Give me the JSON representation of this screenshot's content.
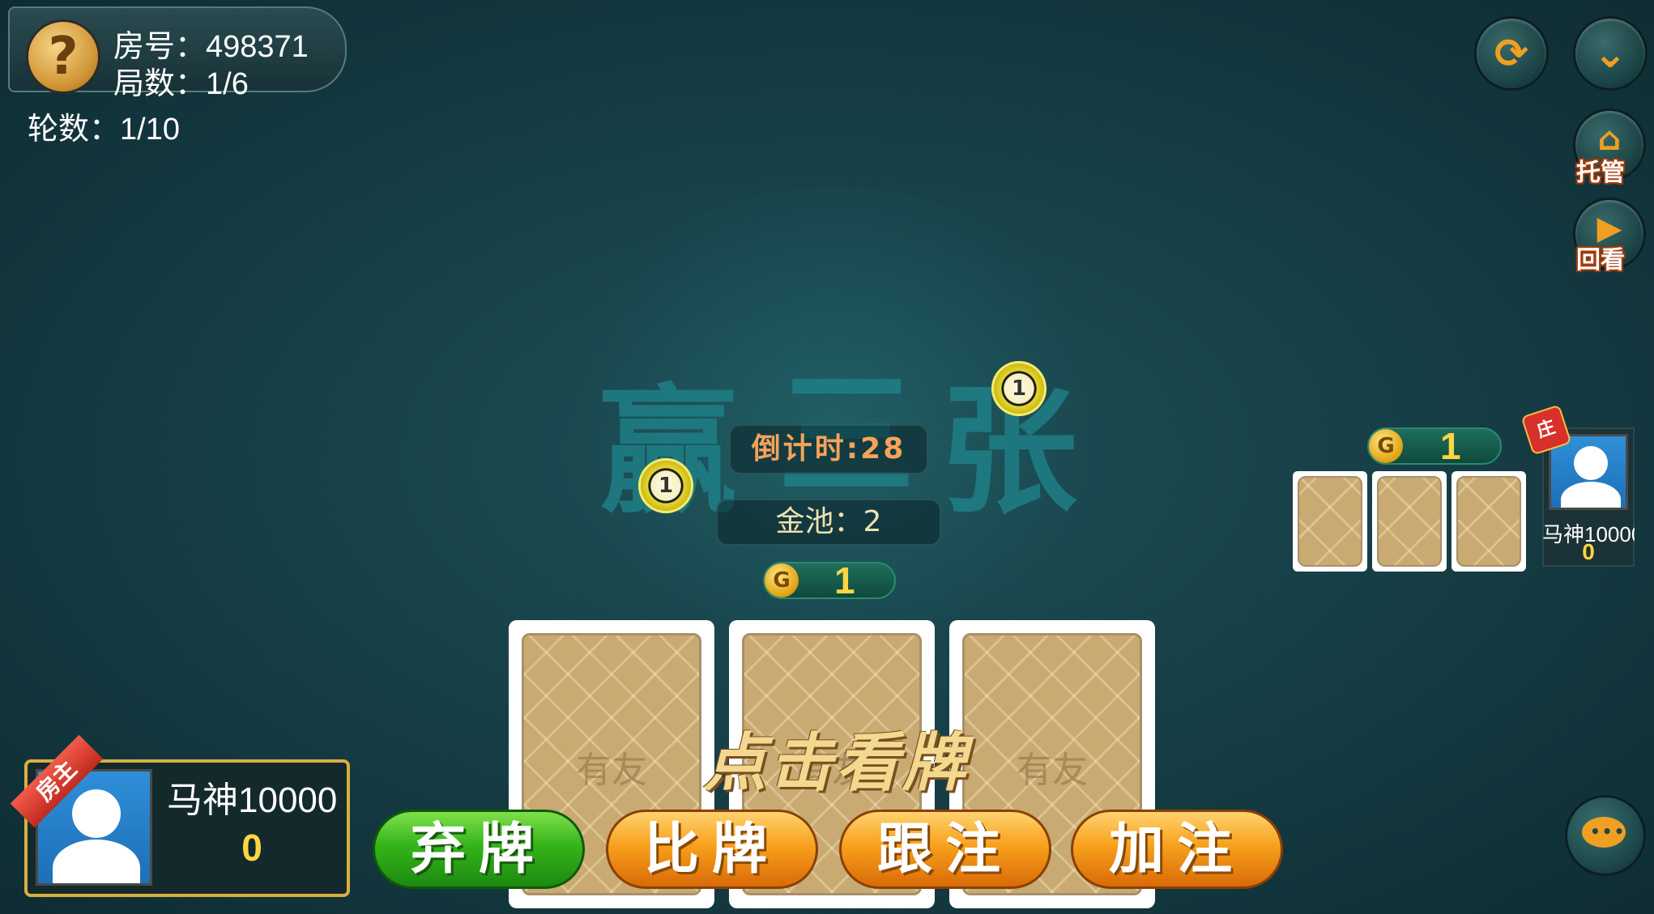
{
  "room": {
    "room_label": "房号：498371",
    "game_label": "局数：1/6",
    "round_label": "轮数：1/10"
  },
  "table": {
    "logo_text": [
      "赢",
      "三",
      "张"
    ],
    "countdown": "倒计时:28",
    "pot": "金池：2",
    "peek_hint": "点击看牌"
  },
  "controls": {
    "trustee_label": "托管",
    "replay_label": "回看"
  },
  "bets": {
    "self_bet": "1",
    "opponent_bet": "1",
    "chip_value": "1",
    "coin_symbol": "G"
  },
  "actions": {
    "fold": "弃牌",
    "compare": "比牌",
    "call": "跟注",
    "raise": "加注"
  },
  "self_player": {
    "badge": "房主",
    "name": "马神10000",
    "score": "0"
  },
  "opponent": {
    "badge": "庄",
    "name": "马神10000",
    "score": "0"
  },
  "card_back_mark": "有友",
  "colors": {
    "table": "#174048",
    "accent_gold": "#ffd640",
    "fold_green": "#35b41a",
    "action_orange": "#f7a11c"
  }
}
